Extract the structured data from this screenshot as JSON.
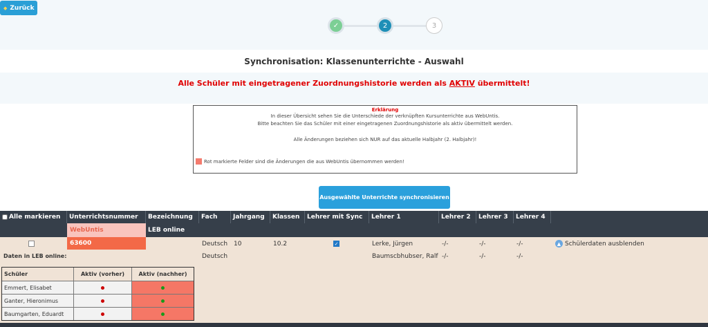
{
  "nav": {
    "back_label": "Zurück"
  },
  "stepper": {
    "step2": "2",
    "step3": "3"
  },
  "page_title": "Synchronisation: Klassenunterrichte - Auswahl",
  "warning": {
    "prefix": "Alle Schüler mit eingetragener Zuordnungshistorie werden als ",
    "keyword": "AKTIV",
    "suffix": " übermittelt!"
  },
  "info": {
    "title": "Erklärung",
    "line1": "In dieser Übersicht sehen Sie die Unterschiede der verknüpften Kursunterrichte aus WebUntis.",
    "line2": "Bitte beachten Sie das Schüler mit einer eingetragenen Zuordnungshistorie als aktiv übermittelt werden.",
    "line3": "Alle Änderungen beziehen sich NUR auf das aktuelle Halbjahr (2. Halbjahr)!",
    "legend": "Rot markierte Felder sind die Änderungen die aus WebUntis übernommen werden!"
  },
  "sync_button": "Ausgewählte Unterrichte synchronisieren",
  "table": {
    "headers": {
      "select_all": "Alle markieren",
      "nr": "Unterrichtsnummer",
      "bez": "Bezeichnung",
      "fach": "Fach",
      "jahrgang": "Jahrgang",
      "klassen": "Klassen",
      "lehrer_sync": "Lehrer mit Sync",
      "lehrer1": "Lehrer 1",
      "lehrer2": "Lehrer 2",
      "lehrer3": "Lehrer 3",
      "lehrer4": "Lehrer 4"
    },
    "source_webuntis": "WebUntis",
    "source_leb": "LEB online",
    "row": {
      "nr": "63600",
      "fach": "Deutsch",
      "jahrgang": "10",
      "klassen": "10.2",
      "lehrer1": "Lerke, Jürgen",
      "lehrer2": "-/-",
      "lehrer3": "-/-",
      "lehrer4": "-/-",
      "hide_label": "Schülerdaten ausblenden"
    },
    "leb_row": {
      "label": "Daten in LEB online:",
      "fach": "Deutsch",
      "lehrer1": "Baumscbhubser, Ralf",
      "lehrer2": "-/-",
      "lehrer3": "-/-",
      "lehrer4": "-/-"
    }
  },
  "students": {
    "headers": {
      "name": "Schüler",
      "prev": "Aktiv (vorher)",
      "next": "Aktiv (nachher)"
    },
    "rows": [
      {
        "name": "Emmert, Elisabet"
      },
      {
        "name": "Ganter, Hieronimus"
      },
      {
        "name": "Baumgarten, Eduardt"
      }
    ]
  },
  "colors": {
    "accent": "#2a9fd6",
    "changed": "#f57766",
    "prev_dot": "#cc0000",
    "next_dot": "#1a9a1a"
  }
}
